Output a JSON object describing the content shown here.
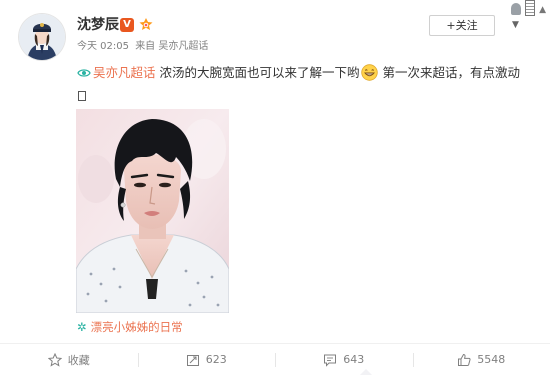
{
  "post": {
    "username": "沈梦辰",
    "verified_badge": "V",
    "follow_label": "+关注",
    "more_icon": "chevron-down-icon",
    "meta": {
      "time": "今天 02:05",
      "source": "来自 吴亦凡超话"
    },
    "text": {
      "topic_link": "吴亦凡超话",
      "part1": "浓汤的大腕宽面也可以来了解一下哟",
      "part2": "第一次来超话，有点激动",
      "trailing_glyph": "□"
    },
    "topic_tag": "漂亮小姊姊的日常"
  },
  "actions": {
    "favorite": "收藏",
    "repost": "623",
    "comment": "643",
    "like": "5548"
  },
  "colors": {
    "link": "#eb7350",
    "follow_plus": "#ff8200",
    "verified": "#e9571f",
    "muted": "#808080"
  }
}
